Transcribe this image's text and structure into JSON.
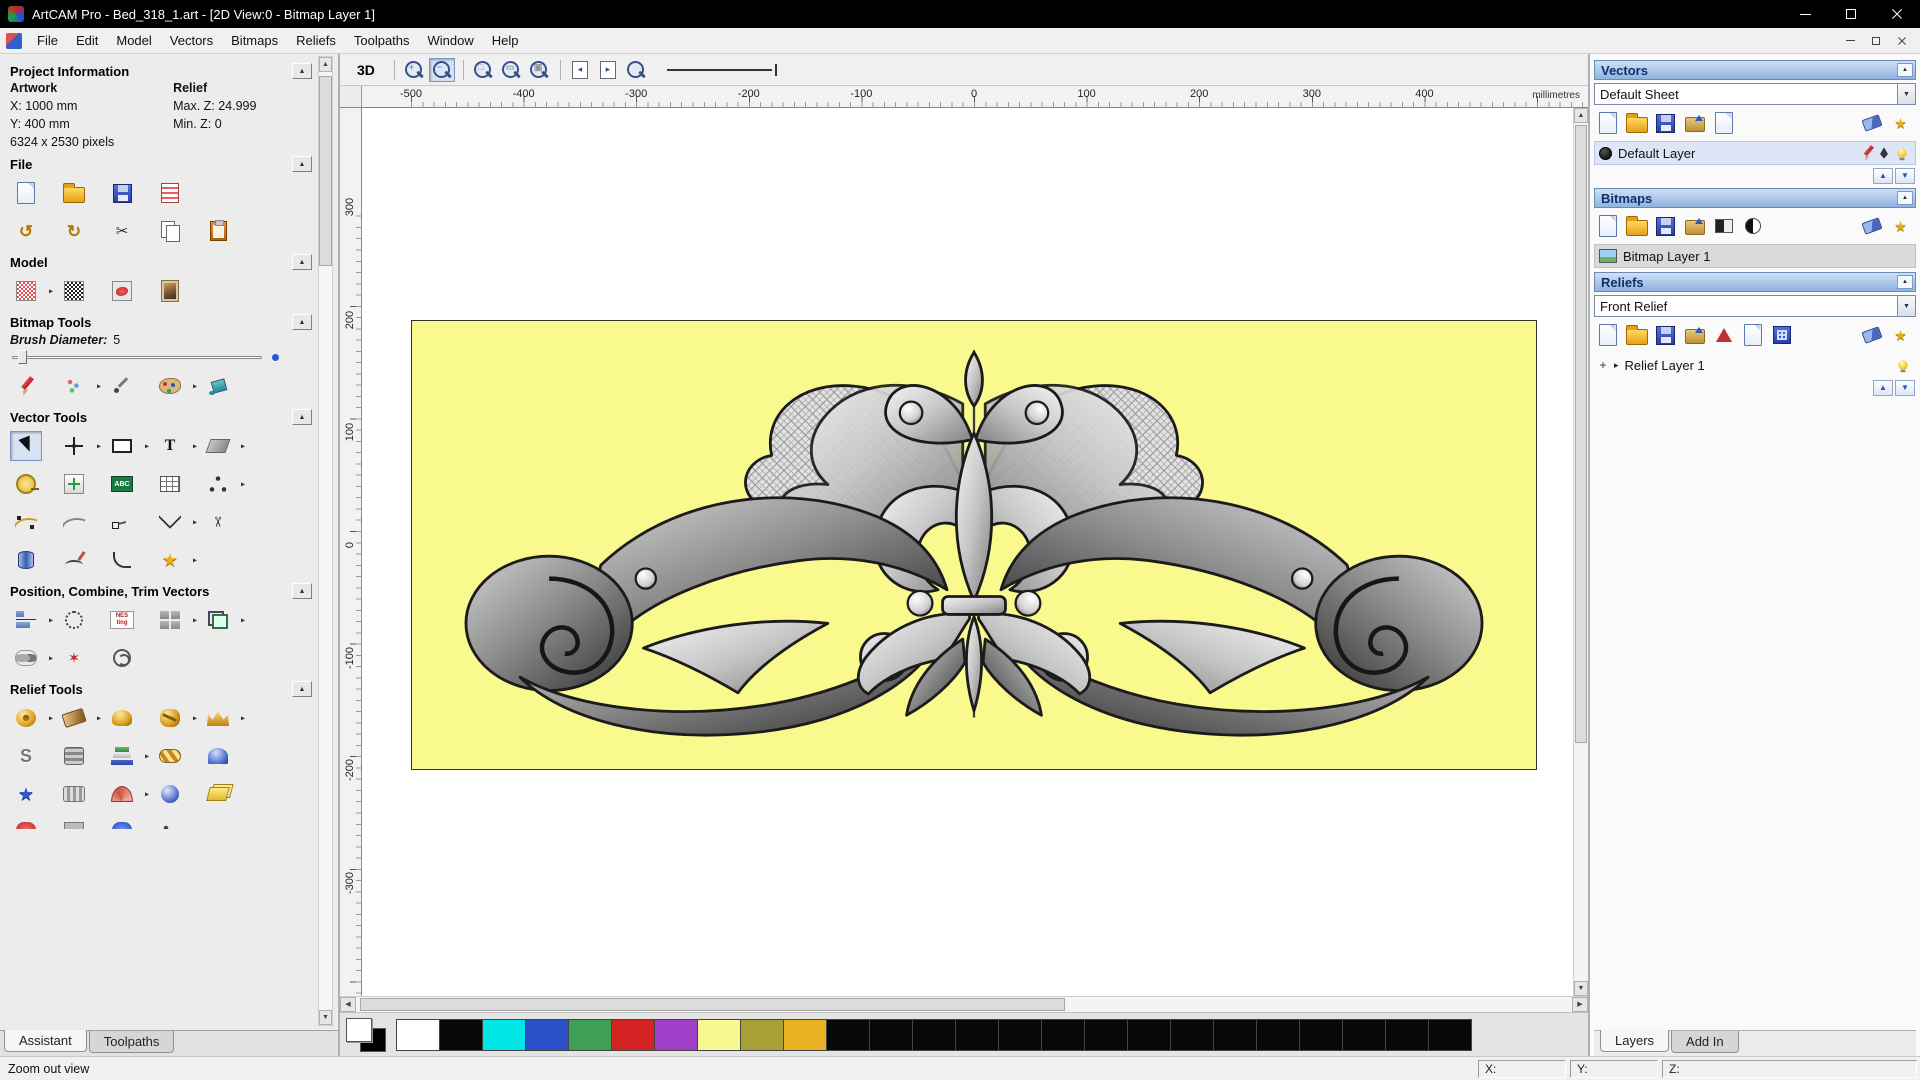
{
  "ui": {
    "caret": "▸",
    "up": "▲",
    "down": "▼",
    "left": "◀",
    "right": "▶"
  },
  "colors": {
    "canvas_bg": "#f9f98e",
    "titlebar_bg": "#000000",
    "header_grad_from": "#cfe0f4",
    "header_grad_to": "#8fb2e0"
  },
  "window": {
    "title": "ArtCAM Pro - Bed_318_1.art - [2D View:0 - Bitmap Layer 1]"
  },
  "menu": {
    "items": [
      "File",
      "Edit",
      "Model",
      "Vectors",
      "Bitmaps",
      "Reliefs",
      "Toolpaths",
      "Window",
      "Help"
    ]
  },
  "assistant": {
    "tabs": [
      {
        "label": "Assistant",
        "active": true
      },
      {
        "label": "Toolpaths",
        "active": false
      }
    ],
    "project": {
      "title": "Project Information",
      "artwork_heading": "Artwork",
      "relief_heading": "Relief",
      "artwork_x": "X: 1000 mm",
      "artwork_y": "Y: 400 mm",
      "artwork_pixels": "6324 x 2530 pixels",
      "relief_max": "Max. Z: 24.999",
      "relief_min": "Min. Z: 0"
    },
    "file": {
      "title": "File",
      "row1": [
        {
          "n": "new-model",
          "s": "page"
        },
        {
          "n": "open-model",
          "s": "folder"
        },
        {
          "n": "save-model",
          "s": "floppy"
        },
        {
          "n": "record-macro",
          "s": "notes"
        }
      ],
      "row2": [
        {
          "n": "undo",
          "s": "ggold",
          "g": "↺"
        },
        {
          "n": "redo",
          "s": "ggold",
          "g": "↻"
        },
        {
          "n": "cut",
          "s": "gdark",
          "g": "✂"
        },
        {
          "n": "copy",
          "s": "copy"
        },
        {
          "n": "paste",
          "s": "paste"
        }
      ]
    },
    "model": {
      "title": "Model",
      "row1": [
        {
          "n": "adjust-model",
          "s": "dither-red",
          "c": true
        },
        {
          "n": "greyscale-model",
          "s": "dither-bw"
        },
        {
          "n": "sculpt-model",
          "s": "paintmodel"
        },
        {
          "n": "bitmap-to-relief",
          "s": "mona"
        }
      ]
    },
    "bitmap_tools": {
      "title": "Bitmap Tools",
      "brush_label": "Brush Diameter:",
      "brush_value": "5",
      "row1": [
        {
          "n": "paint-tool",
          "s": "pencil"
        },
        {
          "n": "spray-tool",
          "s": "spray",
          "c": true
        },
        {
          "n": "colour-picker",
          "s": "dropper"
        },
        {
          "n": "palette-tool",
          "s": "paletteico",
          "c": true
        },
        {
          "n": "flood-fill",
          "s": "bucket"
        }
      ]
    },
    "vector_tools": {
      "title": "Vector Tools",
      "row1": [
        {
          "n": "select-vectors",
          "s": "cursor",
          "p": true
        },
        {
          "n": "transform-vectors",
          "s": "xform",
          "c": true
        },
        {
          "n": "create-rectangle",
          "s": "rect",
          "c": true
        },
        {
          "n": "create-text",
          "s": "gtext",
          "g": "T",
          "c": true
        },
        {
          "n": "vector-mirror",
          "s": "slant",
          "c": true
        }
      ],
      "row2": [
        {
          "n": "measure-tool",
          "s": "tape"
        },
        {
          "n": "create-polyline",
          "s": "pluscross"
        },
        {
          "n": "text-on-curve",
          "s": "abc",
          "g": "ABC"
        },
        {
          "n": "snap-grid",
          "s": "gridico"
        },
        {
          "n": "point-editor",
          "s": "dotstri",
          "c": true
        }
      ],
      "row3": [
        {
          "n": "create-curve",
          "s": "curveico"
        },
        {
          "n": "smooth-curve",
          "s": "waveico"
        },
        {
          "n": "node-editing",
          "s": "nodesico"
        },
        {
          "n": "join-vectors",
          "s": "zigzag",
          "c": true
        },
        {
          "n": "trim-vectors",
          "s": "cutx",
          "g": "✂"
        }
      ],
      "row4": [
        {
          "n": "offset-vector",
          "s": "cyl"
        },
        {
          "n": "freehand-draw",
          "s": "freehand"
        },
        {
          "n": "create-fillet",
          "s": "fillet"
        },
        {
          "n": "wrap-vectors",
          "s": "gstar",
          "g": "★",
          "c": true
        }
      ]
    },
    "position_tools": {
      "title": "Position, Combine, Trim Vectors",
      "row1": [
        {
          "n": "align-vectors",
          "s": "alignico",
          "c": true
        },
        {
          "n": "circular-array",
          "s": "circarr"
        },
        {
          "n": "nesting",
          "s": "nesting",
          "g": "NES\nting"
        },
        {
          "n": "block-array",
          "s": "blocks",
          "c": true
        },
        {
          "n": "group-vectors",
          "s": "groupico",
          "c": true
        }
      ],
      "row2": [
        {
          "n": "weld-vectors",
          "s": "weldico",
          "c": true
        },
        {
          "n": "vector-doctor",
          "s": "stampred",
          "g": "✶"
        },
        {
          "n": "create-spiral",
          "s": "spiralico"
        }
      ]
    },
    "relief_tools": {
      "title": "Relief Tools",
      "row1": [
        {
          "n": "shape-editor",
          "s": "golddonut",
          "c": true
        },
        {
          "n": "sculpting-tool",
          "s": "chisel",
          "c": true
        },
        {
          "n": "smooth-relief",
          "s": "golddome"
        },
        {
          "n": "texture-relief",
          "s": "goldknot",
          "c": true
        },
        {
          "n": "relief-crown",
          "s": "goldcrown",
          "c": true
        }
      ],
      "row2": [
        {
          "n": "smoothing-tool",
          "s": "scurve",
          "g": "S"
        },
        {
          "n": "weave-wizard",
          "s": "weaveico"
        },
        {
          "n": "relief-layers",
          "s": "books",
          "c": true
        },
        {
          "n": "braid-wizard",
          "s": "goldbraid"
        },
        {
          "n": "dome-wizard",
          "s": "bluedome"
        }
      ],
      "row3": [
        {
          "n": "star-wizard",
          "s": "bluestar",
          "g": "★"
        },
        {
          "n": "ripple-texture",
          "s": "ridges"
        },
        {
          "n": "fan-texture",
          "s": "fanred",
          "c": true
        },
        {
          "n": "texture-sphere",
          "s": "texsphere"
        },
        {
          "n": "offset-relief",
          "s": "sheets"
        }
      ],
      "row4": [
        {
          "n": "extra-tool-1",
          "s": "partred"
        },
        {
          "n": "extra-tool-2",
          "s": "partgray"
        },
        {
          "n": "extra-tool-3",
          "s": "partblue"
        },
        {
          "n": "extra-tool-4",
          "s": "partdots"
        }
      ]
    }
  },
  "viewport": {
    "toolbar": {
      "view3d": "3D",
      "icons": [
        {
          "n": "zoom-in",
          "s": "mag",
          "g": "+"
        },
        {
          "n": "zoom-out",
          "s": "mag",
          "g": "−",
          "p": true
        },
        {
          "n": "sep1",
          "s": "sep"
        },
        {
          "n": "zoom-box",
          "s": "mag",
          "g": "□"
        },
        {
          "n": "zoom-page",
          "s": "mag",
          "g": "▭"
        },
        {
          "n": "zoom-objects",
          "s": "mag",
          "g": "▣"
        },
        {
          "n": "sep2",
          "s": "sep"
        },
        {
          "n": "snapshot-left",
          "s": "pagearrow",
          "g": "◂"
        },
        {
          "n": "snapshot-right",
          "s": "pagearrow",
          "g": "▸"
        },
        {
          "n": "zoom-previous",
          "s": "mag",
          "g": ""
        }
      ]
    },
    "ruler_unit": "millimetres",
    "h_ticks": [
      -500,
      -400,
      -300,
      -200,
      -100,
      0,
      100,
      200,
      300,
      400
    ],
    "v_ticks": [
      300,
      200,
      100,
      0,
      -100,
      -200,
      -300
    ]
  },
  "palette": {
    "primary": "#ffffff",
    "secondary": "#000000",
    "colors": [
      "#ffffff",
      "#080808",
      "#00e6e6",
      "#2a50c8",
      "#3fa055",
      "#d42222",
      "#a040c8",
      "#f8f890",
      "#a8a032",
      "#e8b122",
      "#080808",
      "#080808",
      "#080808",
      "#080808",
      "#080808",
      "#080808",
      "#080808",
      "#080808",
      "#080808",
      "#080808",
      "#080808",
      "#080808",
      "#080808",
      "#080808",
      "#080808"
    ]
  },
  "layers_panel": {
    "vectors": {
      "title": "Vectors",
      "sheet": "Default Sheet",
      "layer": "Default Layer",
      "icons": [
        {
          "n": "vector-layer-new",
          "s": "page"
        },
        {
          "n": "vector-layer-open",
          "s": "folder"
        },
        {
          "n": "vector-layer-save",
          "s": "floppy"
        },
        {
          "n": "vector-layer-import",
          "s": "folderarrow"
        },
        {
          "n": "vector-layer-export",
          "s": "page"
        },
        {
          "n": "gap1",
          "s": "gap"
        },
        {
          "n": "vector-layer-delete",
          "s": "eraser"
        },
        {
          "n": "vector-layer-merge",
          "s": "wandsm",
          "g": "★"
        }
      ],
      "row_icons": [
        {
          "n": "vector-layer-edit",
          "s": "pencil"
        },
        {
          "n": "vector-layer-snap",
          "s": "pennib"
        },
        {
          "n": "vector-layer-visibility",
          "s": "bulb"
        }
      ],
      "updown": [
        {
          "n": "vector-layer-move-up",
          "s": "btnarrow",
          "g": "▲"
        },
        {
          "n": "vector-layer-move-down",
          "s": "btnarrow",
          "g": "▼"
        }
      ]
    },
    "bitmaps": {
      "title": "Bitmaps",
      "layer": "Bitmap Layer 1",
      "icons": [
        {
          "n": "bitmap-layer-new",
          "s": "page"
        },
        {
          "n": "bitmap-layer-open",
          "s": "folder"
        },
        {
          "n": "bitmap-layer-save",
          "s": "floppy"
        },
        {
          "n": "bitmap-layer-import",
          "s": "folderarrow"
        },
        {
          "n": "bitmap-layer-adjust",
          "s": "halfbw"
        },
        {
          "n": "bitmap-layer-contrast",
          "s": "contrastico"
        },
        {
          "n": "gap2",
          "s": "gap"
        },
        {
          "n": "bitmap-layer-delete",
          "s": "eraser"
        },
        {
          "n": "bitmap-layer-merge",
          "s": "wandsm",
          "g": "★"
        }
      ]
    },
    "reliefs": {
      "title": "Reliefs",
      "relief": "Front Relief",
      "layer": "Relief Layer 1",
      "expand_glyph": "+",
      "icons": [
        {
          "n": "relief-layer-new",
          "s": "page"
        },
        {
          "n": "relief-layer-open",
          "s": "folder"
        },
        {
          "n": "relief-layer-save",
          "s": "floppy"
        },
        {
          "n": "relief-layer-import",
          "s": "folderarrow"
        },
        {
          "n": "relief-layer-triangulate",
          "s": "pyramid"
        },
        {
          "n": "relief-layer-export",
          "s": "page"
        },
        {
          "n": "relief-layer-save-composite",
          "s": "gridfloppy"
        },
        {
          "n": "gap3",
          "s": "gap"
        },
        {
          "n": "relief-layer-delete",
          "s": "eraser"
        },
        {
          "n": "relief-layer-merge",
          "s": "wandsm",
          "g": "★"
        }
      ],
      "row_icons": [
        {
          "n": "relief-layer-visibility",
          "s": "bulb"
        }
      ],
      "updown": [
        {
          "n": "relief-layer-move-up",
          "s": "btnarrow",
          "g": "▲"
        },
        {
          "n": "relief-layer-move-down",
          "s": "btnarrow",
          "g": "▼"
        }
      ]
    },
    "tabs": [
      {
        "label": "Layers",
        "active": true
      },
      {
        "label": "Add In",
        "active": false
      }
    ]
  },
  "status": {
    "message": "Zoom out view",
    "fields": [
      "X:",
      "Y:",
      "Z:"
    ]
  }
}
